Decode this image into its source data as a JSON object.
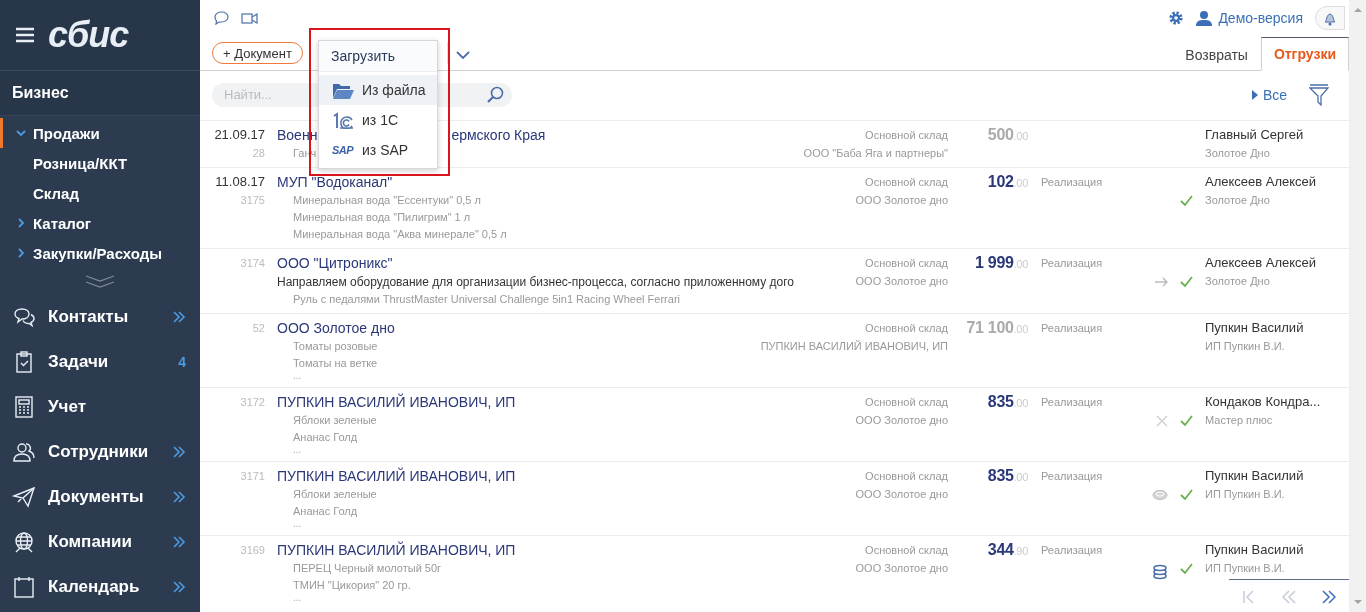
{
  "sidebar": {
    "logo": "сбис",
    "section": "Бизнес",
    "nav": [
      {
        "label": "Продажи",
        "kind": "folder",
        "expanded": true,
        "selected": true
      },
      {
        "label": "Розница/ККТ",
        "kind": "leaf",
        "selected": false
      },
      {
        "label": "Склад",
        "kind": "leaf",
        "selected": false
      },
      {
        "label": "Каталог",
        "kind": "folder",
        "expanded": false,
        "selected": false
      },
      {
        "label": "Закупки/Расходы",
        "kind": "folder",
        "expanded": false,
        "selected": false
      }
    ],
    "apps": [
      {
        "label": "Контакты",
        "expandable": true
      },
      {
        "label": "Задачи",
        "expandable": false,
        "count": "4"
      },
      {
        "label": "Учет",
        "expandable": false
      },
      {
        "label": "Сотрудники",
        "expandable": true
      },
      {
        "label": "Документы",
        "expandable": true
      },
      {
        "label": "Компании",
        "expandable": true
      },
      {
        "label": "Календарь",
        "expandable": true
      }
    ]
  },
  "header": {
    "account": "Демо-версия",
    "add_button": "+ Документ",
    "tabs": [
      {
        "label": "Возвраты",
        "selected": false
      },
      {
        "label": "Отгрузки",
        "selected": true
      }
    ],
    "search": {
      "placeholder": "Найти..."
    },
    "filter_link": "Все"
  },
  "upload_menu": {
    "title": "Загрузить",
    "items": [
      {
        "label": "Из файла",
        "kind": "file",
        "highlighted": true
      },
      {
        "label": "из 1С",
        "kind": "onec",
        "highlighted": false
      },
      {
        "label": "из SAP",
        "kind": "sap",
        "badge": "SAP",
        "highlighted": false
      }
    ]
  },
  "documents": [
    {
      "date": "21.09.17",
      "number": "28",
      "title_parts": [
        "Военн",
        "ермского Края"
      ],
      "lines": [
        "Ганч"
      ],
      "warehouse": "Основной склад",
      "org": "ООО \"Баба Яга и партнеры\"",
      "amount": "500",
      "cents": ".00",
      "muted": true,
      "person": "Главный Сергей",
      "person_org": "Золотое Дно"
    },
    {
      "date": "11.08.17",
      "number": "3175",
      "title_parts": [
        "МУП \"Водоканал\""
      ],
      "lines": [
        "Минеральная вода \"Ессентуки\" 0,5 л",
        "Минеральная вода \"Пилигрим\" 1 л",
        "Минеральная вода \"Аква минерале\" 0,5 л"
      ],
      "warehouse": "Основной склад",
      "org": "ООО Золотое дно",
      "amount": "102",
      "cents": ".00",
      "muted": false,
      "type": "Реализация",
      "status_icons": [
        {
          "kind": "check"
        }
      ],
      "person": "Алексеев Алексей",
      "person_org": "Золотое Дно"
    },
    {
      "number": "3174",
      "title_parts": [
        "ООО \"Цитроникс\""
      ],
      "description": "Направляем оборудование для организации бизнес-процесса, согласно приложенному дого",
      "lines": [
        "Руль с педалями ThrustMaster Universal Challenge 5in1 Racing Wheel Ferrari"
      ],
      "warehouse": "Основной склад",
      "org": "ООО Золотое дно",
      "amount": "1 999",
      "cents": ".00",
      "muted": false,
      "type": "Реализация",
      "status_icons": [
        {
          "kind": "arrow"
        },
        {
          "kind": "check"
        }
      ],
      "person": "Алексеев Алексей",
      "person_org": "Золотое Дно"
    },
    {
      "number": "52",
      "title_parts": [
        "ООО Золотое дно"
      ],
      "lines": [
        "Томаты розовые",
        "Томаты на ветке"
      ],
      "more": "...",
      "warehouse": "Основной склад",
      "org": "ПУПКИН ВАСИЛИЙ ИВАНОВИЧ, ИП",
      "amount": "71 100",
      "cents": ".00",
      "muted": true,
      "type": "Реализация",
      "person": "Пупкин Василий",
      "person_org": "ИП Пупкин В.И."
    },
    {
      "number": "3172",
      "title_parts": [
        "ПУПКИН ВАСИЛИЙ ИВАНОВИЧ, ИП"
      ],
      "lines": [
        "Яблоки зеленые",
        "Ананас Голд"
      ],
      "more": "...",
      "warehouse": "Основной склад",
      "org": "ООО Золотое дно",
      "amount": "835",
      "cents": ".00",
      "muted": false,
      "type": "Реализация",
      "status_icons": [
        {
          "kind": "cross"
        },
        {
          "kind": "check"
        }
      ],
      "person": "Кондаков Кондра...",
      "person_org": "Мастер плюс"
    },
    {
      "number": "3171",
      "title_parts": [
        "ПУПКИН ВАСИЛИЙ ИВАНОВИЧ, ИП"
      ],
      "lines": [
        "Яблоки зеленые",
        "Ананас Голд"
      ],
      "more": "...",
      "warehouse": "Основной склад",
      "org": "ООО Золотое дно",
      "amount": "835",
      "cents": ".00",
      "muted": false,
      "type": "Реализация",
      "status_icons": [
        {
          "kind": "coin"
        },
        {
          "kind": "check"
        }
      ],
      "person": "Пупкин Василий",
      "person_org": "ИП Пупкин В.И."
    },
    {
      "number": "3169",
      "title_parts": [
        "ПУПКИН ВАСИЛИЙ ИВАНОВИЧ, ИП"
      ],
      "lines": [
        "ПЕРЕЦ Черный молотый 50г",
        "ТМИН \"Цикория\" 20 гр."
      ],
      "more": "...",
      "warehouse": "Основной склад",
      "org": "ООО Золотое дно",
      "amount": "344",
      "cents": ".90",
      "muted": false,
      "type": "Реализация",
      "status_icons": [
        {
          "kind": "coins"
        },
        {
          "kind": "check"
        }
      ],
      "person": "Пупкин Василий",
      "person_org": "ИП Пупкин В.И."
    }
  ],
  "pager": [
    {
      "kind": "first",
      "disabled": true
    },
    {
      "kind": "prev",
      "disabled": true
    },
    {
      "kind": "next",
      "disabled": false
    }
  ]
}
